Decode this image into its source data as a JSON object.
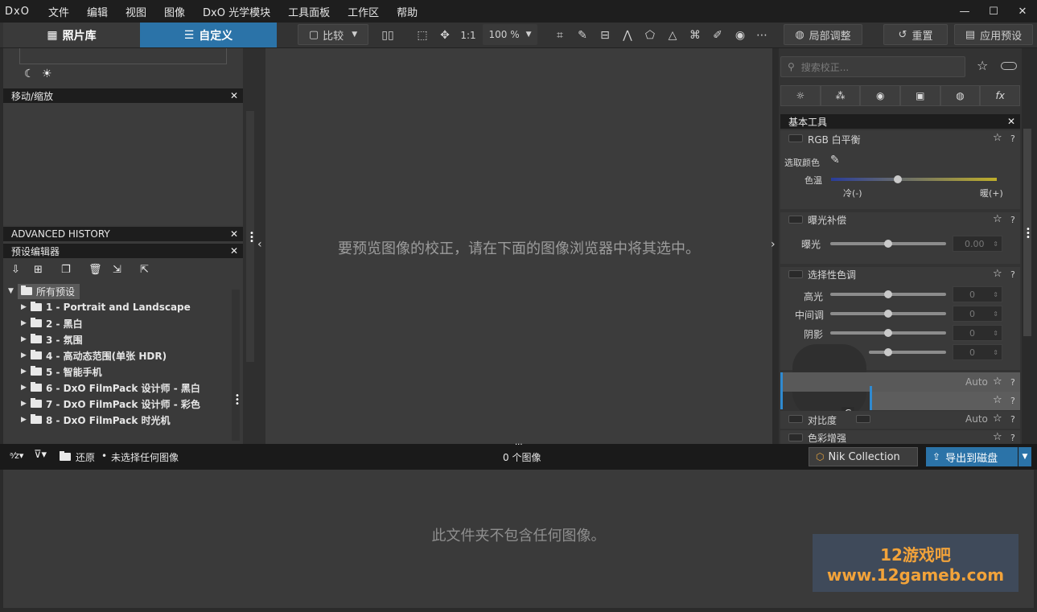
{
  "menubar": {
    "logo": "DxO",
    "items": [
      "文件",
      "编辑",
      "视图",
      "图像",
      "DxO 光学模块",
      "工具面板",
      "工作区",
      "帮助"
    ],
    "window_controls": [
      "—",
      "☐",
      "✕"
    ]
  },
  "toolbar": {
    "tab_photo_library": "照片库",
    "tab_customize": "自定义",
    "compare": "比较",
    "ratio": "1:1",
    "zoom": "100 %",
    "local_adjust": "局部调整",
    "reset": "重置",
    "apply_preset": "应用预设"
  },
  "left_panel": {
    "move_zoom_title": "移动/缩放",
    "advanced_history_title": "ADVANCED HISTORY",
    "preset_editor_title": "预设编辑器",
    "root_folder": "所有预设",
    "presets": [
      "1 - Portrait and Landscape",
      "2 - 黑白",
      "3 - 氛围",
      "4 - 高动态范围(单张 HDR)",
      "5 - 智能手机",
      "6 - DxO FilmPack 设计师 - 黑白",
      "7 - DxO FilmPack 设计师 - 彩色",
      "8 - DxO FilmPack 时光机"
    ]
  },
  "viewer": {
    "message": "要预览图像的校正，请在下面的图像浏览器中将其选中。"
  },
  "right_panel": {
    "search_placeholder": "搜索校正...",
    "basic_tools_title": "基本工具",
    "white_balance": {
      "title": "RGB 白平衡",
      "pick_color": "选取颜色",
      "temperature": "色温",
      "cold": "冷(-)",
      "warm": "暖(+)"
    },
    "exposure": {
      "title": "曝光补偿",
      "label": "曝光",
      "value": "0.00"
    },
    "selective_tone": {
      "title": "选择性色调",
      "highlights": "高光",
      "midtones": "中间调",
      "shadows": "阴影",
      "values": [
        "0",
        "0",
        "0",
        "0"
      ]
    },
    "rows": {
      "auto1": "Auto",
      "contrast": "对比度",
      "auto2": "Auto",
      "color_boost": "色彩增强"
    },
    "stray_letter": "C"
  },
  "filmbar": {
    "restore": "还原",
    "no_selection": "未选择任何图像",
    "image_count": "0 个图像",
    "nik": "Nik Collection",
    "export": "导出到磁盘"
  },
  "filmstrip": {
    "message": "此文件夹不包含任何图像。"
  },
  "watermark": {
    "line1": "12游戏吧",
    "line2": "www.12gameb.com"
  }
}
